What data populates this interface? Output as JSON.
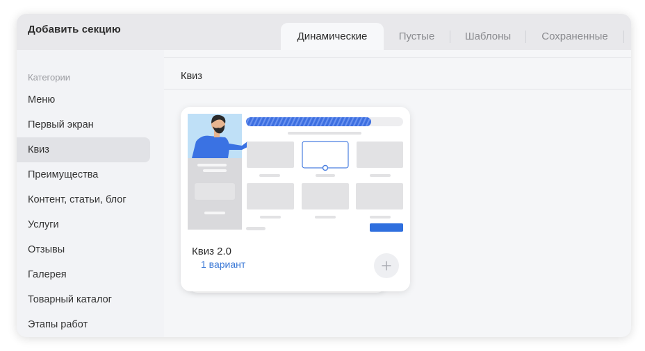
{
  "header": {
    "title": "Добавить секцию"
  },
  "tabs": [
    {
      "label": "Динамические",
      "active": true
    },
    {
      "label": "Пустые",
      "active": false
    },
    {
      "label": "Шаблоны",
      "active": false
    },
    {
      "label": "Сохраненные",
      "active": false
    }
  ],
  "sidebar": {
    "heading": "Категории",
    "items": [
      {
        "label": "Меню"
      },
      {
        "label": "Первый экран"
      },
      {
        "label": "Квиз",
        "active": true
      },
      {
        "label": "Преимущества"
      },
      {
        "label": "Контент, статьи, блог"
      },
      {
        "label": "Услуги"
      },
      {
        "label": "Отзывы"
      },
      {
        "label": "Галерея"
      },
      {
        "label": "Товарный каталог"
      },
      {
        "label": "Этапы работ"
      }
    ]
  },
  "main": {
    "section_label": "Квиз",
    "cards": [
      {
        "title": "Квиз 2.0",
        "variant_label": "1 вариант",
        "add_icon": "plus-icon"
      }
    ]
  },
  "colors": {
    "accent": "#3a78d6",
    "progress": "#3d6fe0",
    "active_bg": "#e1e2e6",
    "illustration_bg": "#bfe0f7"
  }
}
